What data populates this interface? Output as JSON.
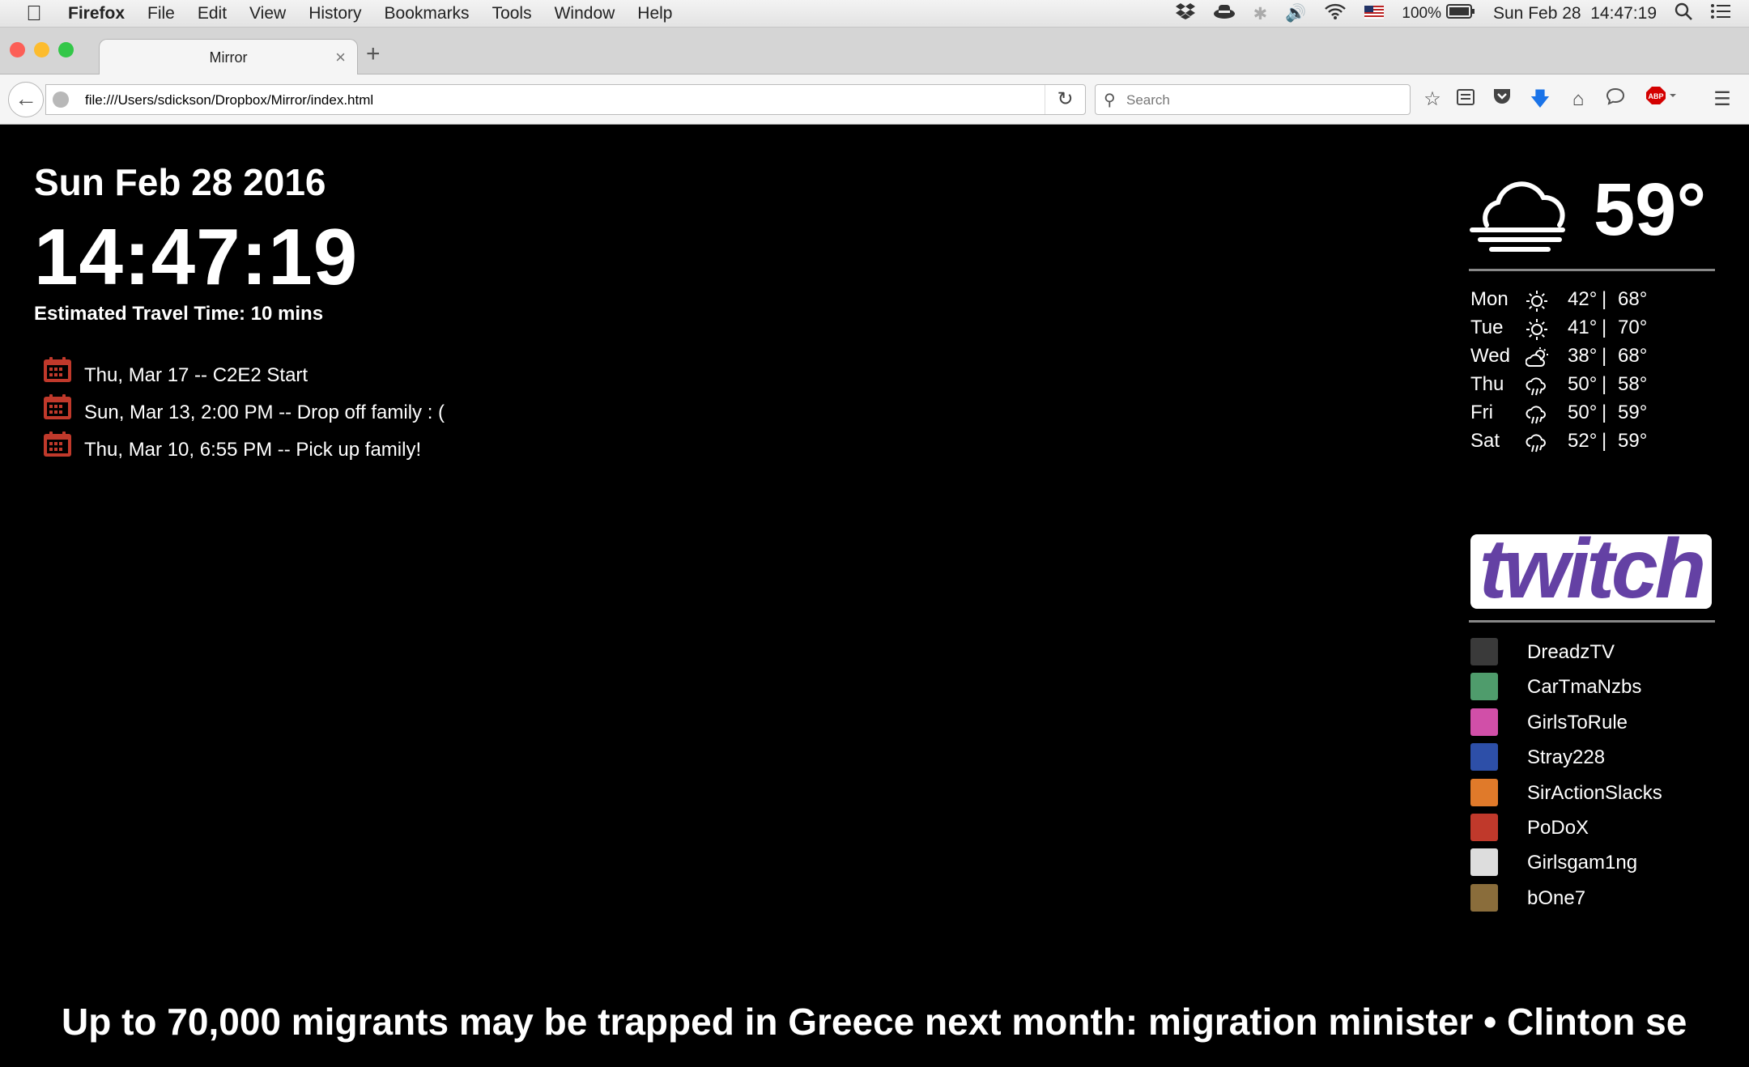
{
  "menubar": {
    "app_name": "Firefox",
    "items": [
      "File",
      "Edit",
      "View",
      "History",
      "Bookmarks",
      "Tools",
      "Window",
      "Help"
    ],
    "battery": "100%",
    "datetime": "Sun Feb 28  14:47:19"
  },
  "tab": {
    "title": "Mirror"
  },
  "navbar": {
    "url": "file:///Users/sdickson/Dropbox/Mirror/index.html",
    "search_placeholder": "Search"
  },
  "mirror": {
    "date": "Sun Feb 28 2016",
    "time": "14:47:19",
    "travel_time": "Estimated Travel Time: 10 mins",
    "events": [
      {
        "text": "Thu, Mar 17 -- C2E2 Start"
      },
      {
        "text": "Sun, Mar 13, 2:00 PM -- Drop off family : ("
      },
      {
        "text": "Thu, Mar 10, 6:55 PM -- Pick up family!"
      }
    ],
    "weather": {
      "current_temp": "59°",
      "current_icon": "cloudy-windy-icon",
      "forecast": [
        {
          "day": "Mon",
          "icon": "sun-icon",
          "low": "42°",
          "high": "68°"
        },
        {
          "day": "Tue",
          "icon": "sun-icon",
          "low": "41°",
          "high": "70°"
        },
        {
          "day": "Wed",
          "icon": "partly-cloudy-icon",
          "low": "38°",
          "high": "68°"
        },
        {
          "day": "Thu",
          "icon": "rain-icon",
          "low": "50°",
          "high": "58°"
        },
        {
          "day": "Fri",
          "icon": "rain-icon",
          "low": "50°",
          "high": "59°"
        },
        {
          "day": "Sat",
          "icon": "rain-icon",
          "low": "52°",
          "high": "59°"
        }
      ]
    },
    "twitch": {
      "logo_text": "twitch",
      "brand_color": "#6441a4",
      "streamers": [
        {
          "name": "DreadzTV",
          "color": "#3a3a3a"
        },
        {
          "name": "CarTmaNzbs",
          "color": "#4f9c6c"
        },
        {
          "name": "GirlsToRule",
          "color": "#d14fa8"
        },
        {
          "name": "Stray228",
          "color": "#2d4fa8"
        },
        {
          "name": "SirActionSlacks",
          "color": "#e07a2a"
        },
        {
          "name": "PoDoX",
          "color": "#c0392b"
        },
        {
          "name": "Girlsgam1ng",
          "color": "#dddddd"
        },
        {
          "name": "bOne7",
          "color": "#8a6d3b"
        }
      ]
    },
    "news_ticker": "Up to 70,000 migrants may be trapped in Greece next month: migration minister • Clinton se"
  }
}
